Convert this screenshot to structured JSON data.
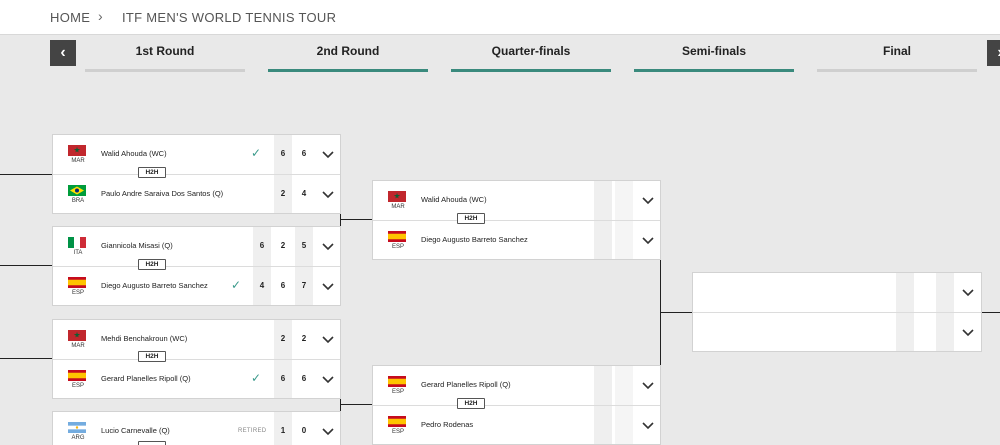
{
  "breadcrumb": {
    "home": "HOME",
    "separator": "›",
    "current": "ITF MEN'S WORLD TENNIS TOUR"
  },
  "nav": {
    "prev": "‹",
    "next": "›"
  },
  "tabs": [
    {
      "label": "1st Round",
      "active": false
    },
    {
      "label": "2nd Round",
      "active": true
    },
    {
      "label": "Quarter-finals",
      "active": true
    },
    {
      "label": "Semi-finals",
      "active": true
    },
    {
      "label": "Final",
      "active": false
    }
  ],
  "h2h_label": "H2H",
  "round1": [
    {
      "p1": {
        "name": "Walid Ahouda (WC)",
        "country": "MAR",
        "winner": true,
        "scores": [
          "6",
          "6",
          ""
        ]
      },
      "p2": {
        "name": "Paulo Andre Saraiva Dos Santos (Q)",
        "country": "BRA",
        "winner": false,
        "scores": [
          "2",
          "4",
          ""
        ]
      }
    },
    {
      "p1": {
        "name": "Giannicola Misasi (Q)",
        "country": "ITA",
        "winner": false,
        "scores": [
          "6",
          "2",
          "5"
        ]
      },
      "p2": {
        "name": "Diego Augusto Barreto Sanchez",
        "country": "ESP",
        "winner": true,
        "scores": [
          "4",
          "6",
          "7"
        ]
      }
    },
    {
      "p1": {
        "name": "Mehdi Benchakroun (WC)",
        "country": "MAR",
        "winner": false,
        "scores": [
          "2",
          "2",
          ""
        ]
      },
      "p2": {
        "name": "Gerard Planelles Ripoll (Q)",
        "country": "ESP",
        "winner": true,
        "scores": [
          "6",
          "6",
          ""
        ]
      }
    },
    {
      "p1": {
        "name": "Lucio Carnevalle (Q)",
        "country": "ARG",
        "winner": false,
        "status": "RETIRED",
        "scores": [
          "1",
          "0",
          ""
        ]
      }
    }
  ],
  "round2": [
    {
      "p1": {
        "name": "Walid Ahouda (WC)",
        "country": "MAR"
      },
      "p2": {
        "name": "Diego Augusto Barreto Sanchez",
        "country": "ESP"
      }
    },
    {
      "p1": {
        "name": "Gerard Planelles Ripoll (Q)",
        "country": "ESP"
      },
      "p2": {
        "name": "Pedro Rodenas",
        "country": "ESP"
      }
    }
  ],
  "colors": {
    "accent": "#3a8a7d",
    "check": "#3a9a8b",
    "nav_bg": "#444444"
  }
}
